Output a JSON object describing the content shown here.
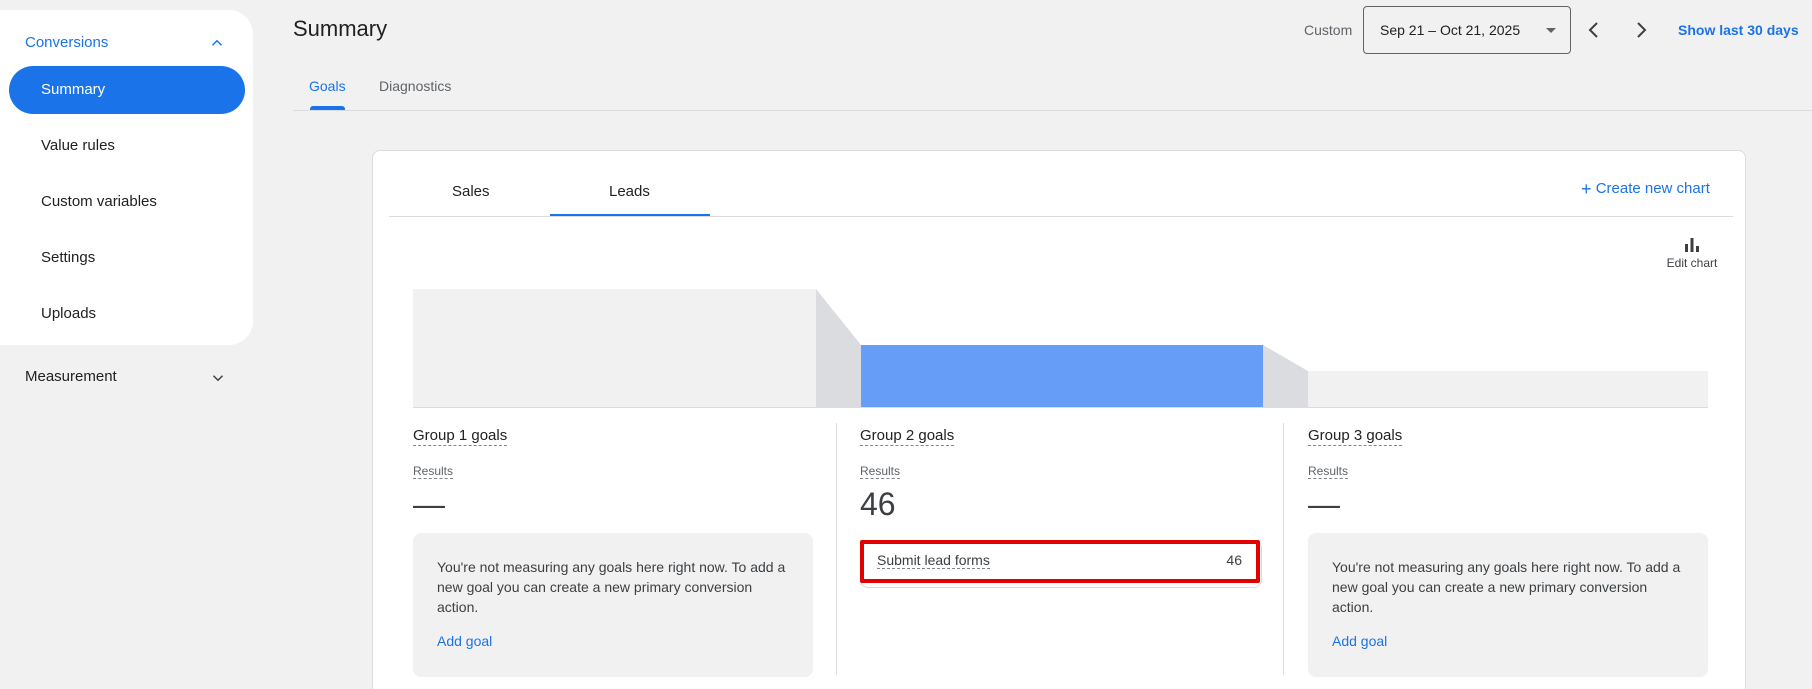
{
  "sidebar": {
    "section": "Conversions",
    "items": [
      {
        "label": "Summary",
        "active": true
      },
      {
        "label": "Value rules"
      },
      {
        "label": "Custom variables"
      },
      {
        "label": "Settings"
      },
      {
        "label": "Uploads"
      }
    ],
    "measurement": "Measurement"
  },
  "header": {
    "title": "Summary",
    "custom_label": "Custom",
    "date_range": "Sep 21 – Oct 21, 2025",
    "show_last": "Show last 30 days"
  },
  "tabs": [
    "Goals",
    "Diagnostics"
  ],
  "card": {
    "tabs": [
      "Sales",
      "Leads"
    ],
    "create_chart": "Create new chart",
    "edit_chart": "Edit chart",
    "groups": [
      {
        "title": "Group 1 goals",
        "results_label": "Results",
        "results": "—",
        "empty_text": "You're not measuring any goals here right now. To add a new goal you can create a new primary conversion action.",
        "add_goal": "Add goal"
      },
      {
        "title": "Group 2 goals",
        "results_label": "Results",
        "results": "46",
        "goal_name": "Submit lead forms",
        "goal_value": "46"
      },
      {
        "title": "Group 3 goals",
        "results_label": "Results",
        "results": "—",
        "empty_text": "You're not measuring any goals here right now. To add a new goal you can create a new primary conversion action.",
        "add_goal": "Add goal"
      }
    ]
  },
  "colors": {
    "accent": "#1a73e8",
    "funnel_active": "#669df6",
    "funnel_empty": "#f1f1f1",
    "highlight": "#e00000"
  }
}
